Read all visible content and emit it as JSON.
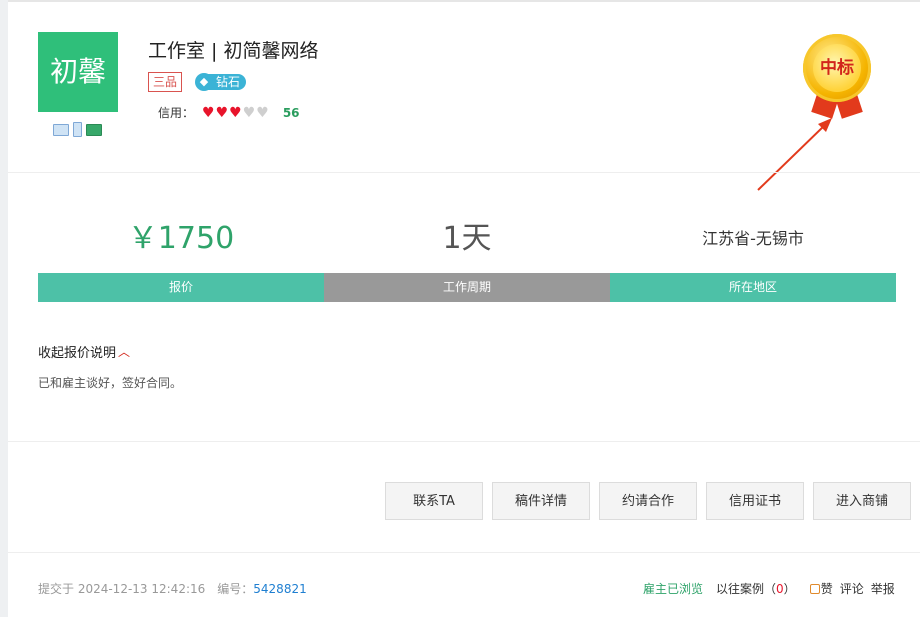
{
  "seller": {
    "avatar_text": "初馨",
    "name": "工作室 | 初简馨网络",
    "grade_badge": "三品",
    "diamond_badge": "钻石",
    "credit_label": "信用：",
    "hearts_filled": 3,
    "hearts_total": 5,
    "credit_score": "56",
    "verify_icons": [
      "id-card-icon",
      "phone-icon",
      "bank-card-icon"
    ]
  },
  "medal": {
    "text": "中标"
  },
  "stats": {
    "price": "￥1750",
    "period": "1天",
    "location": "江苏省-无锡市"
  },
  "tabs": [
    {
      "label": "报价"
    },
    {
      "label": "工作周期"
    },
    {
      "label": "所在地区"
    }
  ],
  "quote_note": {
    "toggle_label": "收起报价说明",
    "text": "已和雇主谈好，签好合同。"
  },
  "actions": [
    {
      "label": "联系TA"
    },
    {
      "label": "稿件详情"
    },
    {
      "label": "约请合作"
    },
    {
      "label": "信用证书"
    },
    {
      "label": "进入商铺"
    }
  ],
  "footer": {
    "submitted": "提交于 2024-12-13 12:42:16",
    "id_label": "编号：",
    "id_value": "5428821",
    "browsed": "雇主已浏览",
    "cases_prefix": "以往案例（",
    "cases_count": "0",
    "cases_suffix": "）",
    "like": "赞",
    "comment": "评论",
    "report": "举报"
  },
  "colors": {
    "accent_green": "#4dc1a7",
    "price_green": "#2fa36a",
    "avatar_green": "#2fbf7a",
    "heart_red": "#e8142b"
  }
}
